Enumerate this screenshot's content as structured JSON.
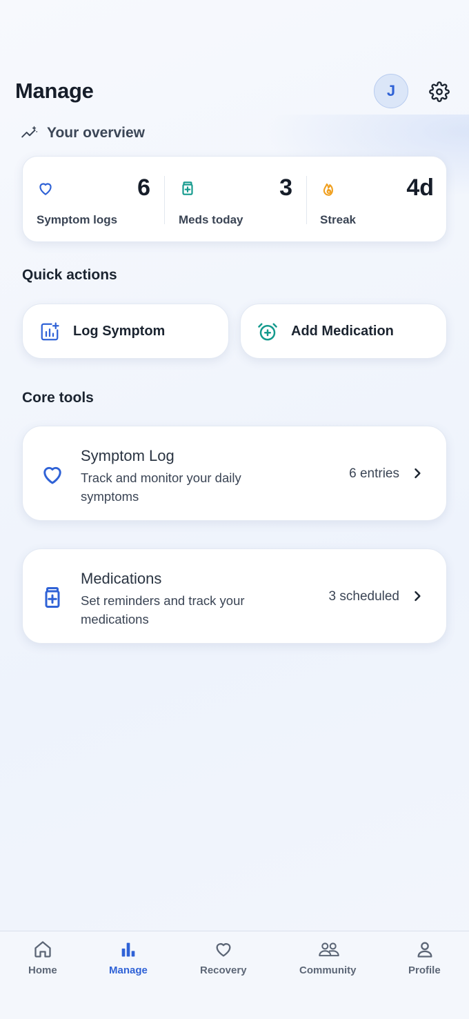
{
  "header": {
    "title": "Manage",
    "avatar_initial": "J",
    "settings_icon": "gear-icon"
  },
  "overview": {
    "title": "Your overview",
    "icon": "trend-icon",
    "stats": [
      {
        "value": "6",
        "label": "Symptom logs",
        "icon": "heart-icon",
        "color": "#2f62d6"
      },
      {
        "value": "3",
        "label": "Meds today",
        "icon": "medicine-bottle-icon",
        "color": "#149a8d"
      },
      {
        "value": "4d",
        "label": "Streak",
        "icon": "flame-icon",
        "color": "#f0a020"
      }
    ]
  },
  "quick_actions": {
    "heading": "Quick actions",
    "items": [
      {
        "label": "Log Symptom",
        "icon": "chart-add-icon",
        "color": "#2f62d6"
      },
      {
        "label": "Add Medication",
        "icon": "alarm-add-icon",
        "color": "#149a8d"
      }
    ]
  },
  "core_tools": {
    "heading": "Core tools",
    "items": [
      {
        "title": "Symptom Log",
        "description": "Track and monitor your daily symptoms",
        "meta": "6 entries",
        "icon": "heart-icon"
      },
      {
        "title": "Medications",
        "description": "Set reminders and track your medications",
        "meta": "3 scheduled",
        "icon": "medicine-bottle-icon"
      }
    ]
  },
  "nav": {
    "items": [
      {
        "label": "Home",
        "icon": "home-icon"
      },
      {
        "label": "Manage",
        "icon": "bar-chart-icon",
        "active": true
      },
      {
        "label": "Recovery",
        "icon": "heart-icon"
      },
      {
        "label": "Community",
        "icon": "people-icon"
      },
      {
        "label": "Profile",
        "icon": "person-icon"
      }
    ]
  },
  "colors": {
    "accent": "#2f62d6",
    "teal": "#149a8d",
    "orange": "#f0a020"
  }
}
